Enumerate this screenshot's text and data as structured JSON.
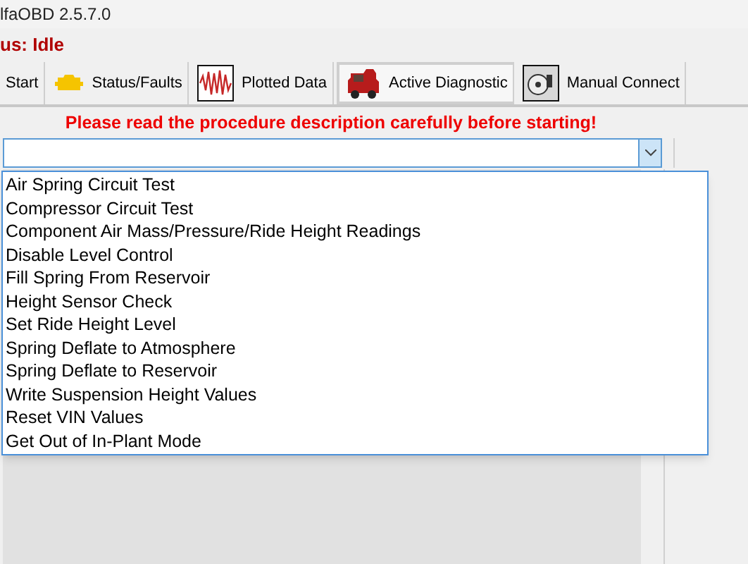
{
  "window": {
    "title": "lfaOBD 2.5.7.0"
  },
  "status": {
    "text": "us: Idle"
  },
  "tabs": [
    {
      "label": "Start",
      "kind": "plain",
      "selected": false
    },
    {
      "label": "Status/Faults",
      "kind": "obd",
      "selected": false
    },
    {
      "label": "Plotted Data",
      "kind": "wave",
      "selected": false
    },
    {
      "label": "Active Diagnostic",
      "kind": "car",
      "selected": true
    },
    {
      "label": "Manual Connect",
      "kind": "disc",
      "selected": false
    }
  ],
  "warning": "Please read the procedure description carefully before starting!",
  "procedure_dropdown": {
    "expanded": true,
    "options": [
      "Air Spring Circuit Test",
      "Compressor Circuit Test",
      "Component Air Mass/Pressure/Ride Height Readings",
      "Disable Level Control",
      "Fill Spring From Reservoir",
      "Height Sensor Check",
      "Set Ride Height Level",
      "Spring Deflate to Atmosphere",
      "Spring Deflate to Reservoir",
      "Write Suspension Height Values",
      "Reset VIN Values",
      "Get Out of In-Plant Mode"
    ]
  }
}
